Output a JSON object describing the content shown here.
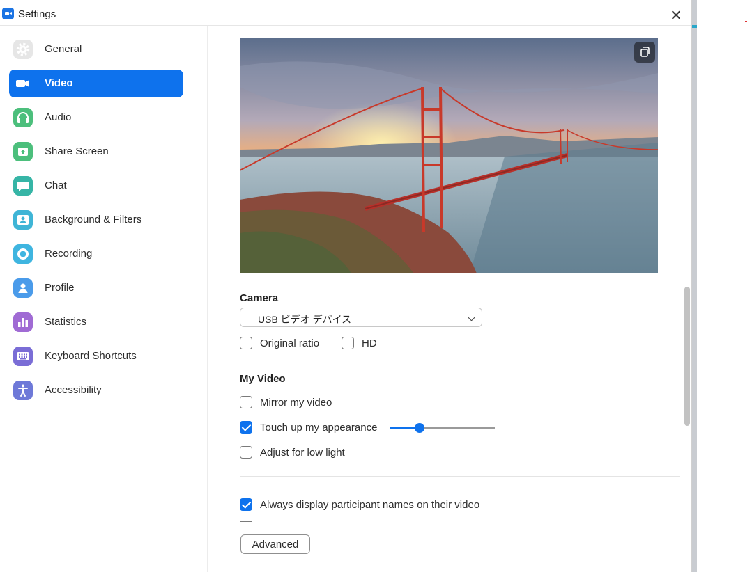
{
  "window": {
    "title": "Settings"
  },
  "sidebar": {
    "items": [
      {
        "label": "General",
        "icon": "gear-icon",
        "color": "#e6e6e6",
        "active": false
      },
      {
        "label": "Video",
        "icon": "video-camera-icon",
        "color": "#ffffff",
        "active": true
      },
      {
        "label": "Audio",
        "icon": "headphones-icon",
        "color": "#4cbf7c",
        "active": false
      },
      {
        "label": "Share Screen",
        "icon": "share-screen-icon",
        "color": "#4cbf7c",
        "active": false
      },
      {
        "label": "Chat",
        "icon": "chat-bubble-icon",
        "color": "#36b5a6",
        "active": false
      },
      {
        "label": "Background & Filters",
        "icon": "background-person-icon",
        "color": "#3fb5d6",
        "active": false
      },
      {
        "label": "Recording",
        "icon": "record-icon",
        "color": "#3fb5e0",
        "active": false
      },
      {
        "label": "Profile",
        "icon": "user-icon",
        "color": "#4a9bea",
        "active": false
      },
      {
        "label": "Statistics",
        "icon": "bar-chart-icon",
        "color": "#a06bd4",
        "active": false
      },
      {
        "label": "Keyboard Shortcuts",
        "icon": "keyboard-icon",
        "color": "#7a6dd6",
        "active": false
      },
      {
        "label": "Accessibility",
        "icon": "accessibility-icon",
        "color": "#6e79d8",
        "active": false
      }
    ]
  },
  "video": {
    "camera_heading": "Camera",
    "camera_select": "USB ビデオ デバイス",
    "original_ratio": {
      "label": "Original ratio",
      "checked": false
    },
    "hd": {
      "label": "HD",
      "checked": false
    },
    "my_video_heading": "My Video",
    "mirror": {
      "label": "Mirror my video",
      "checked": false
    },
    "touch_up": {
      "label": "Touch up my appearance",
      "checked": true,
      "level": 0.28
    },
    "low_light": {
      "label": "Adjust for low light",
      "checked": false
    },
    "names": {
      "label": "Always display participant names on their video",
      "checked": true
    },
    "advanced_label": "Advanced"
  },
  "colors": {
    "accent": "#0e72ed",
    "active_item_bg": "#0e72ed"
  }
}
